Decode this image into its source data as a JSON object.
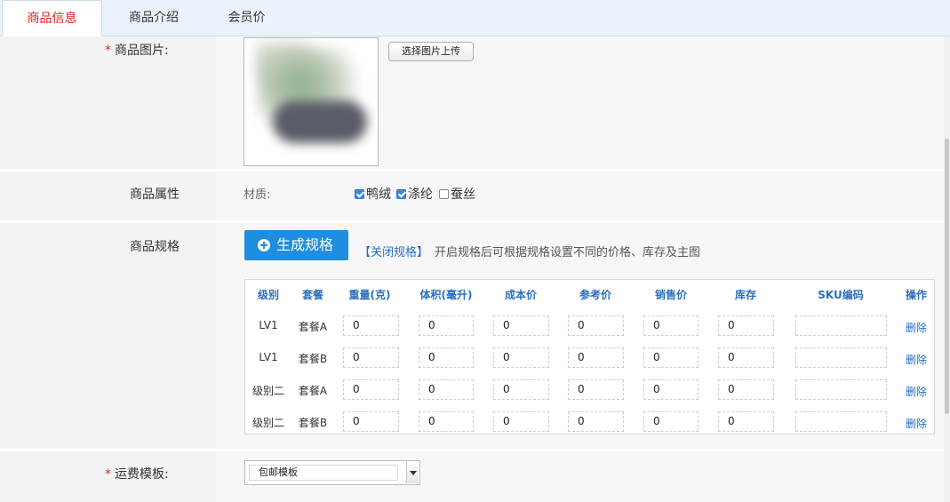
{
  "tabs": [
    {
      "label": "商品信息",
      "active": true
    },
    {
      "label": "商品介绍",
      "active": false
    },
    {
      "label": "会员价",
      "active": false
    }
  ],
  "image_field": {
    "required_mark": "*",
    "label": "商品图片:",
    "upload_button": "选择图片上传"
  },
  "attributes": {
    "label": "商品属性",
    "attr_name": "材质:",
    "options": [
      {
        "label": "鸭绒",
        "checked": true
      },
      {
        "label": "涤纶",
        "checked": true
      },
      {
        "label": "蚕丝",
        "checked": false
      }
    ]
  },
  "spec": {
    "label": "商品规格",
    "generate_button": "生成规格",
    "close_link": "【关闭规格】",
    "tip": "开启规格后可根据规格设置不同的价格、库存及主图",
    "columns": [
      "级别",
      "套餐",
      "重量(克)",
      "体积(毫升)",
      "成本价",
      "参考价",
      "销售价",
      "库存",
      "SKU编码",
      "操作"
    ],
    "rows": [
      {
        "level": "LV1",
        "package": "套餐A",
        "weight": "0",
        "volume": "0",
        "cost": "0",
        "ref_price": "0",
        "sale_price": "0",
        "stock": "0",
        "sku": "",
        "action": "删除"
      },
      {
        "level": "LV1",
        "package": "套餐B",
        "weight": "0",
        "volume": "0",
        "cost": "0",
        "ref_price": "0",
        "sale_price": "0",
        "stock": "0",
        "sku": "",
        "action": "删除"
      },
      {
        "level": "级别二",
        "package": "套餐A",
        "weight": "0",
        "volume": "0",
        "cost": "0",
        "ref_price": "0",
        "sale_price": "0",
        "stock": "0",
        "sku": "",
        "action": "删除"
      },
      {
        "level": "级别二",
        "package": "套餐B",
        "weight": "0",
        "volume": "0",
        "cost": "0",
        "ref_price": "0",
        "sale_price": "0",
        "stock": "0",
        "sku": "",
        "action": "删除"
      }
    ]
  },
  "shipping": {
    "required_mark": "*",
    "label": "运费模板:",
    "selected": "包邮模板"
  },
  "colors": {
    "accent_red": "#d9261c",
    "primary_blue": "#1f8ee0",
    "link_blue": "#1f6fc5",
    "tab_bar": "#eaf3fb"
  },
  "icons": {
    "generate": "plus-circle-icon",
    "select_arrow": "chevron-down-icon"
  }
}
